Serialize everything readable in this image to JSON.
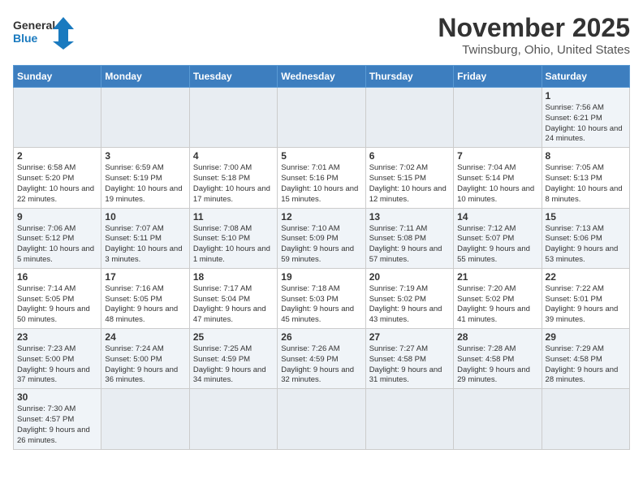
{
  "header": {
    "logo_general": "General",
    "logo_blue": "Blue",
    "title": "November 2025",
    "subtitle": "Twinsburg, Ohio, United States"
  },
  "weekdays": [
    "Sunday",
    "Monday",
    "Tuesday",
    "Wednesday",
    "Thursday",
    "Friday",
    "Saturday"
  ],
  "weeks": [
    [
      {
        "day": "",
        "info": ""
      },
      {
        "day": "",
        "info": ""
      },
      {
        "day": "",
        "info": ""
      },
      {
        "day": "",
        "info": ""
      },
      {
        "day": "",
        "info": ""
      },
      {
        "day": "",
        "info": ""
      },
      {
        "day": "1",
        "info": "Sunrise: 7:56 AM\nSunset: 6:21 PM\nDaylight: 10 hours and 24 minutes."
      }
    ],
    [
      {
        "day": "2",
        "info": "Sunrise: 6:58 AM\nSunset: 5:20 PM\nDaylight: 10 hours and 22 minutes."
      },
      {
        "day": "3",
        "info": "Sunrise: 6:59 AM\nSunset: 5:19 PM\nDaylight: 10 hours and 19 minutes."
      },
      {
        "day": "4",
        "info": "Sunrise: 7:00 AM\nSunset: 5:18 PM\nDaylight: 10 hours and 17 minutes."
      },
      {
        "day": "5",
        "info": "Sunrise: 7:01 AM\nSunset: 5:16 PM\nDaylight: 10 hours and 15 minutes."
      },
      {
        "day": "6",
        "info": "Sunrise: 7:02 AM\nSunset: 5:15 PM\nDaylight: 10 hours and 12 minutes."
      },
      {
        "day": "7",
        "info": "Sunrise: 7:04 AM\nSunset: 5:14 PM\nDaylight: 10 hours and 10 minutes."
      },
      {
        "day": "8",
        "info": "Sunrise: 7:05 AM\nSunset: 5:13 PM\nDaylight: 10 hours and 8 minutes."
      }
    ],
    [
      {
        "day": "9",
        "info": "Sunrise: 7:06 AM\nSunset: 5:12 PM\nDaylight: 10 hours and 5 minutes."
      },
      {
        "day": "10",
        "info": "Sunrise: 7:07 AM\nSunset: 5:11 PM\nDaylight: 10 hours and 3 minutes."
      },
      {
        "day": "11",
        "info": "Sunrise: 7:08 AM\nSunset: 5:10 PM\nDaylight: 10 hours and 1 minute."
      },
      {
        "day": "12",
        "info": "Sunrise: 7:10 AM\nSunset: 5:09 PM\nDaylight: 9 hours and 59 minutes."
      },
      {
        "day": "13",
        "info": "Sunrise: 7:11 AM\nSunset: 5:08 PM\nDaylight: 9 hours and 57 minutes."
      },
      {
        "day": "14",
        "info": "Sunrise: 7:12 AM\nSunset: 5:07 PM\nDaylight: 9 hours and 55 minutes."
      },
      {
        "day": "15",
        "info": "Sunrise: 7:13 AM\nSunset: 5:06 PM\nDaylight: 9 hours and 53 minutes."
      }
    ],
    [
      {
        "day": "16",
        "info": "Sunrise: 7:14 AM\nSunset: 5:05 PM\nDaylight: 9 hours and 50 minutes."
      },
      {
        "day": "17",
        "info": "Sunrise: 7:16 AM\nSunset: 5:05 PM\nDaylight: 9 hours and 48 minutes."
      },
      {
        "day": "18",
        "info": "Sunrise: 7:17 AM\nSunset: 5:04 PM\nDaylight: 9 hours and 47 minutes."
      },
      {
        "day": "19",
        "info": "Sunrise: 7:18 AM\nSunset: 5:03 PM\nDaylight: 9 hours and 45 minutes."
      },
      {
        "day": "20",
        "info": "Sunrise: 7:19 AM\nSunset: 5:02 PM\nDaylight: 9 hours and 43 minutes."
      },
      {
        "day": "21",
        "info": "Sunrise: 7:20 AM\nSunset: 5:02 PM\nDaylight: 9 hours and 41 minutes."
      },
      {
        "day": "22",
        "info": "Sunrise: 7:22 AM\nSunset: 5:01 PM\nDaylight: 9 hours and 39 minutes."
      }
    ],
    [
      {
        "day": "23",
        "info": "Sunrise: 7:23 AM\nSunset: 5:00 PM\nDaylight: 9 hours and 37 minutes."
      },
      {
        "day": "24",
        "info": "Sunrise: 7:24 AM\nSunset: 5:00 PM\nDaylight: 9 hours and 36 minutes."
      },
      {
        "day": "25",
        "info": "Sunrise: 7:25 AM\nSunset: 4:59 PM\nDaylight: 9 hours and 34 minutes."
      },
      {
        "day": "26",
        "info": "Sunrise: 7:26 AM\nSunset: 4:59 PM\nDaylight: 9 hours and 32 minutes."
      },
      {
        "day": "27",
        "info": "Sunrise: 7:27 AM\nSunset: 4:58 PM\nDaylight: 9 hours and 31 minutes."
      },
      {
        "day": "28",
        "info": "Sunrise: 7:28 AM\nSunset: 4:58 PM\nDaylight: 9 hours and 29 minutes."
      },
      {
        "day": "29",
        "info": "Sunrise: 7:29 AM\nSunset: 4:58 PM\nDaylight: 9 hours and 28 minutes."
      }
    ],
    [
      {
        "day": "30",
        "info": "Sunrise: 7:30 AM\nSunset: 4:57 PM\nDaylight: 9 hours and 26 minutes."
      },
      {
        "day": "",
        "info": ""
      },
      {
        "day": "",
        "info": ""
      },
      {
        "day": "",
        "info": ""
      },
      {
        "day": "",
        "info": ""
      },
      {
        "day": "",
        "info": ""
      },
      {
        "day": "",
        "info": ""
      }
    ]
  ]
}
